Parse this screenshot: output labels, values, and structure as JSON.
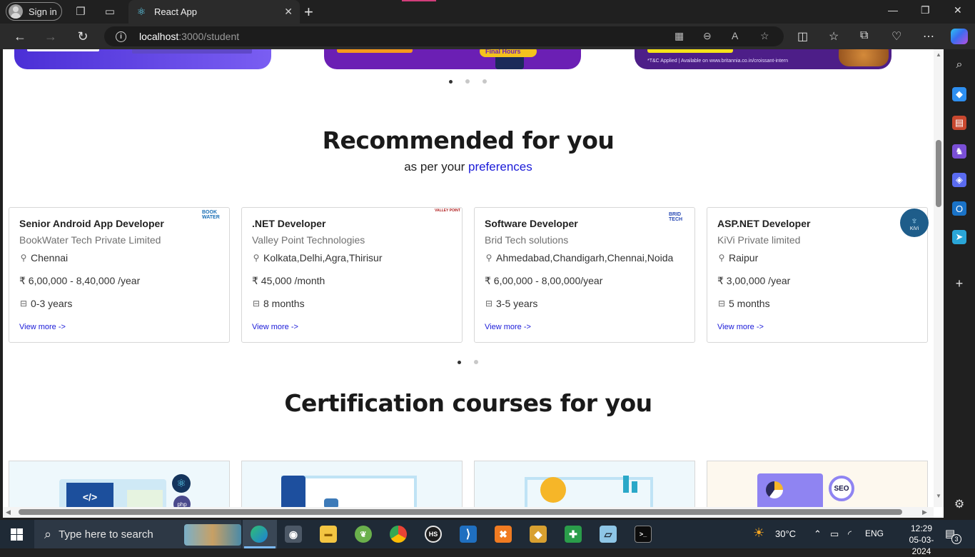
{
  "browser": {
    "signin_label": "Sign in",
    "tab_title": "React App",
    "url_host": "localhost",
    "url_rest": ":3000/student"
  },
  "page": {
    "recommended": {
      "title": "Recommended for you",
      "subtitle_prefix": "as per your ",
      "subtitle_link": "preferences",
      "jobs": [
        {
          "title": "Senior Android App Developer",
          "company": "BookWater Tech Private Limited",
          "location": "Chennai",
          "salary": "₹ 6,00,000 - 8,40,000 /year",
          "experience": "0-3 years",
          "link": "View more ->",
          "logo": "BOOK WATER"
        },
        {
          "title": ".NET Developer",
          "company": "Valley Point Technologies",
          "location": "Kolkata,Delhi,Agra,Thirisur",
          "salary": "₹ 45,000 /month",
          "experience": "8 months",
          "link": "View more ->",
          "logo": "VALLEY POINT"
        },
        {
          "title": "Software Developer",
          "company": "Brid Tech solutions",
          "location": "Ahmedabad,Chandigarh,Chennai,Noida",
          "salary": "₹ 6,00,000 - 8,00,000/year",
          "experience": "3-5 years",
          "link": "View more ->",
          "logo": "BRID TECH"
        },
        {
          "title": "ASP.NET Developer",
          "company": "KiVi Private limited",
          "location": "Raipur",
          "salary": "₹ 3,00,000 /year",
          "experience": "5 months",
          "link": "View more ->",
          "logo": "KiVi"
        }
      ]
    },
    "certification": {
      "title": "Certification courses for you"
    },
    "banners": {
      "b2_label": "Final Hours",
      "b3_note": "*T&C Applied | Available on www.britannia.co.in/croissant-intern"
    }
  },
  "taskbar": {
    "search_placeholder": "Type here to search",
    "weather": "30°C",
    "language": "ENG",
    "time": "12:29",
    "date": "05-03-2024",
    "notifications": "3"
  },
  "colors": {
    "link": "#1a1ad8",
    "chrome_bg": "#202020",
    "taskbar_bg": "#1f2a36"
  }
}
